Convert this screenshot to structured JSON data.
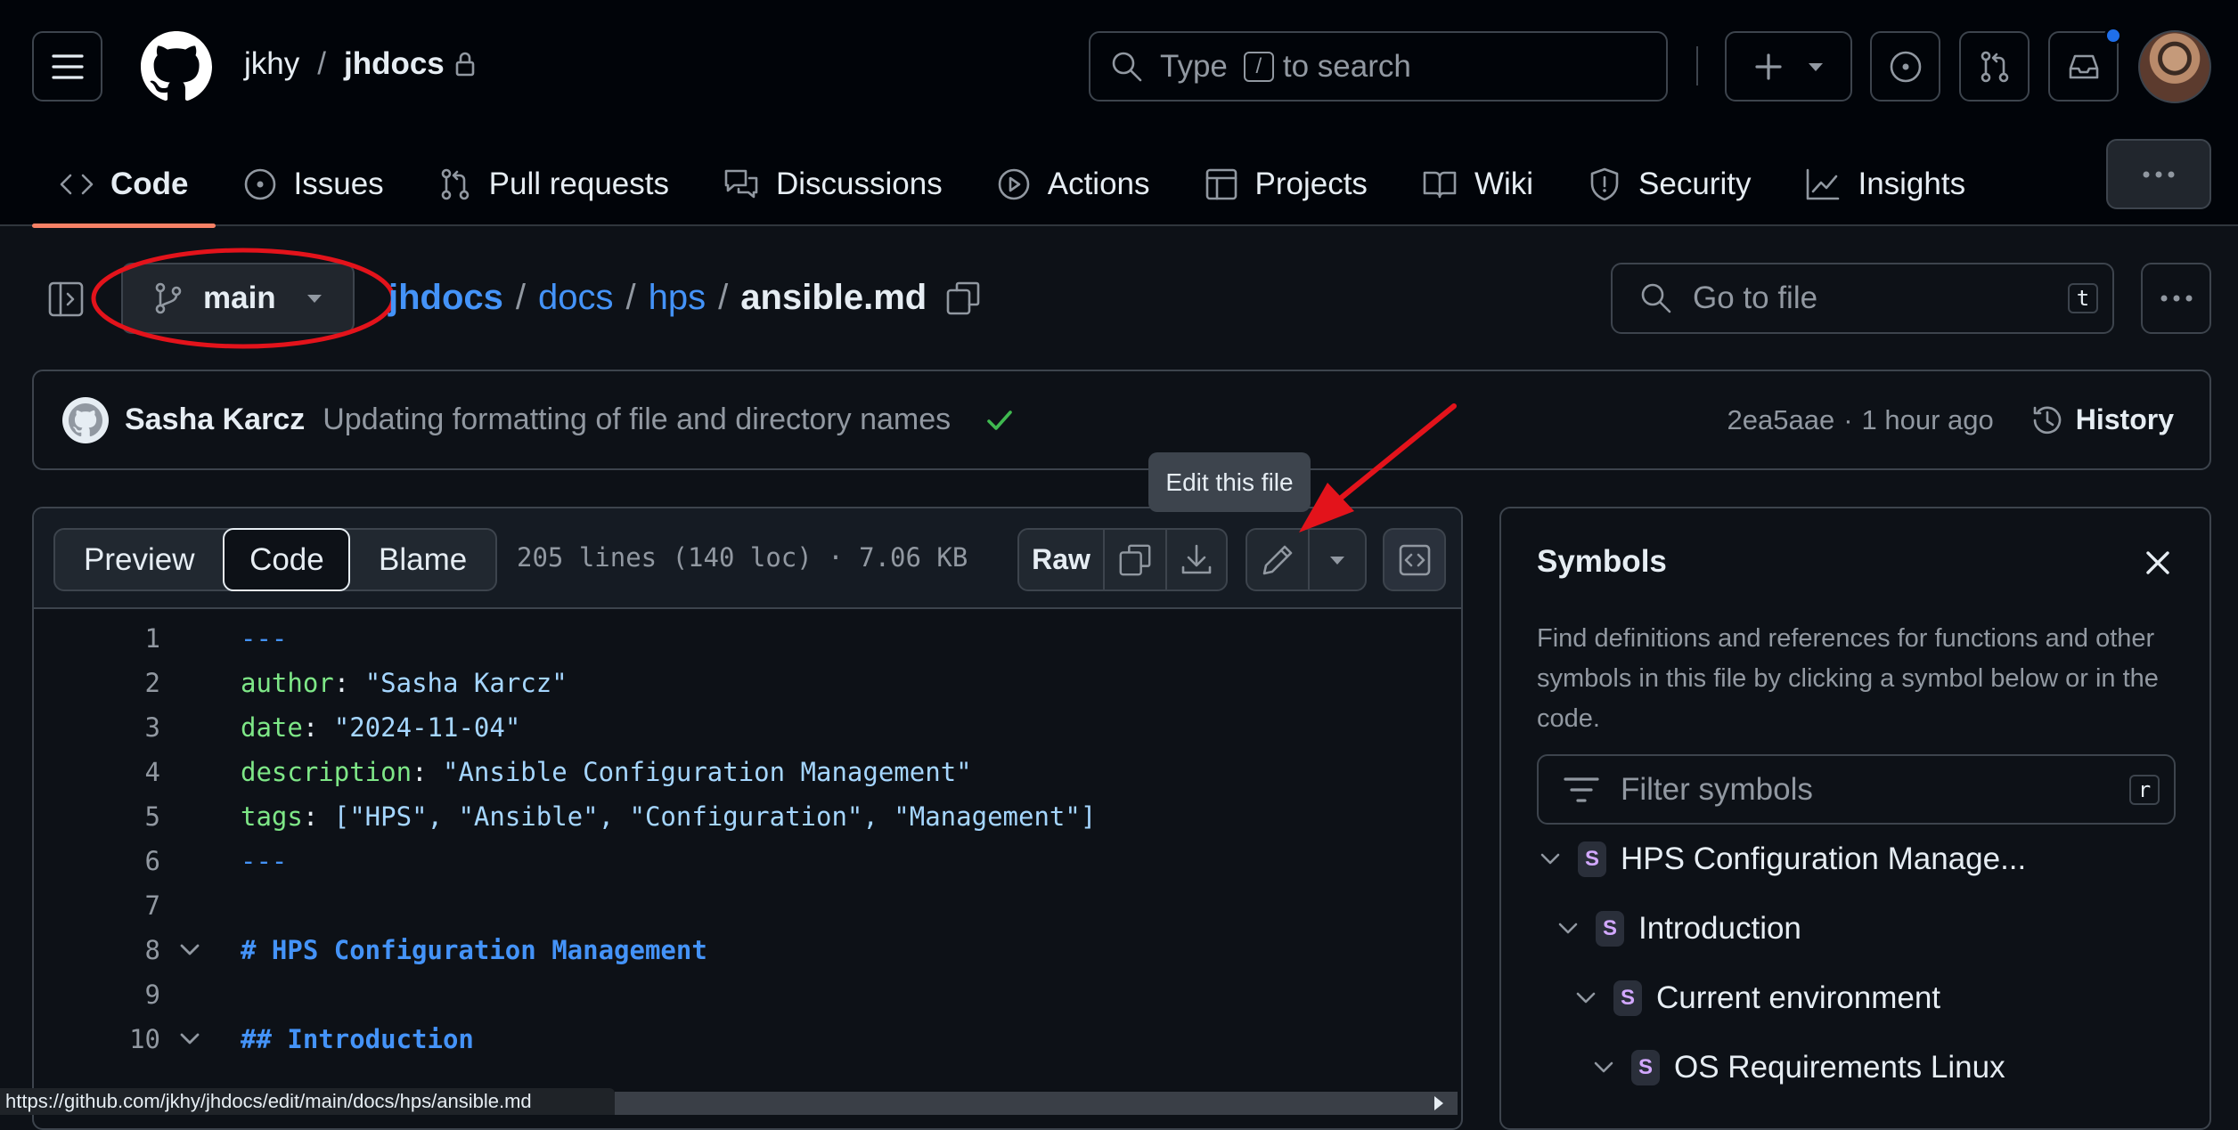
{
  "header": {
    "owner": "jkhy",
    "repo": "jhdocs",
    "search_placeholder_pre": "Type",
    "search_key": "/",
    "search_placeholder_post": "to search"
  },
  "tabs": [
    {
      "label": "Code",
      "icon": "code-icon"
    },
    {
      "label": "Issues",
      "icon": "issue-icon"
    },
    {
      "label": "Pull requests",
      "icon": "pull-request-icon"
    },
    {
      "label": "Discussions",
      "icon": "discussions-icon"
    },
    {
      "label": "Actions",
      "icon": "play-icon"
    },
    {
      "label": "Projects",
      "icon": "table-icon"
    },
    {
      "label": "Wiki",
      "icon": "book-icon"
    },
    {
      "label": "Security",
      "icon": "shield-icon"
    },
    {
      "label": "Insights",
      "icon": "graph-icon"
    }
  ],
  "breadcrumb": {
    "branch": "main",
    "parts": [
      "jhdocs",
      "docs",
      "hps"
    ],
    "file": "ansible.md",
    "goto_placeholder": "Go to file",
    "goto_key": "t"
  },
  "commit": {
    "author": "Sasha Karcz",
    "message": "Updating formatting of file and directory names",
    "sha": "2ea5aae",
    "dot": "·",
    "time": "1 hour ago",
    "history_label": "History"
  },
  "file": {
    "views": [
      "Preview",
      "Code",
      "Blame"
    ],
    "stats": "205 lines (140 loc) · 7.06 KB",
    "raw_label": "Raw",
    "tooltip": "Edit this file",
    "lines": [
      {
        "n": "1",
        "key": "",
        "sep": "",
        "val": "---",
        "kind": "dash"
      },
      {
        "n": "2",
        "key": "author",
        "sep": ": ",
        "val": "\"Sasha Karcz\"",
        "kind": "kv"
      },
      {
        "n": "3",
        "key": "date",
        "sep": ": ",
        "val": "\"2024-11-04\"",
        "kind": "kv"
      },
      {
        "n": "4",
        "key": "description",
        "sep": ": ",
        "val": "\"Ansible Configuration Management\"",
        "kind": "kv"
      },
      {
        "n": "5",
        "key": "tags",
        "sep": ": ",
        "val": "[\"HPS\", \"Ansible\", \"Configuration\", \"Management\"]",
        "kind": "kv"
      },
      {
        "n": "6",
        "key": "",
        "sep": "",
        "val": "---",
        "kind": "dash"
      },
      {
        "n": "7",
        "key": "",
        "sep": "",
        "val": "",
        "kind": "blank"
      },
      {
        "n": "8",
        "key": "",
        "sep": "",
        "val": "# HPS Configuration Management",
        "kind": "heading"
      },
      {
        "n": "9",
        "key": "",
        "sep": "",
        "val": "",
        "kind": "blank"
      },
      {
        "n": "10",
        "key": "",
        "sep": "",
        "val": "## Introduction",
        "kind": "heading"
      }
    ]
  },
  "symbols": {
    "title": "Symbols",
    "description": "Find definitions and references for functions and other symbols in this file by clicking a symbol below or in the code.",
    "filter_placeholder": "Filter symbols",
    "filter_key": "r",
    "badge": "S",
    "items": [
      {
        "label": "HPS Configuration Manage..."
      },
      {
        "label": "Introduction"
      },
      {
        "label": "Current environment"
      },
      {
        "label": "OS Requirements Linux"
      }
    ]
  },
  "statusbar": {
    "url": "https://github.com/jkhy/jhdocs/edit/main/docs/hps/ansible.md"
  },
  "colors": {
    "accent": "#f78166",
    "link": "#4493f8",
    "annotation": "#e3131b",
    "success": "#3fb950"
  }
}
